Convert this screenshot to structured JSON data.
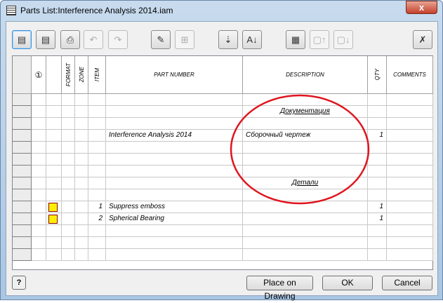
{
  "window": {
    "title": "Parts List:Interference Analysis 2014.iam",
    "close": "x"
  },
  "toolbar": [
    {
      "name": "save-bom-button",
      "glyph": "▤",
      "disabled": false,
      "selected": true
    },
    {
      "name": "column-chooser-button",
      "glyph": "▤",
      "disabled": false
    },
    {
      "name": "print-button",
      "glyph": "⎙",
      "disabled": false
    },
    {
      "name": "undo-button",
      "glyph": "↶",
      "disabled": true
    },
    {
      "name": "redo-button",
      "glyph": "↷",
      "disabled": true
    },
    {
      "name": "edit-button",
      "glyph": "✎",
      "disabled": false
    },
    {
      "name": "group-button",
      "glyph": "⊞",
      "disabled": true
    },
    {
      "name": "renumber-button",
      "glyph": "⇣",
      "disabled": false
    },
    {
      "name": "sort-button",
      "glyph": "A↓",
      "disabled": false
    },
    {
      "name": "add-row-button",
      "glyph": "▦",
      "disabled": false
    },
    {
      "name": "move-up-button",
      "glyph": "▢↑",
      "disabled": true
    },
    {
      "name": "move-down-button",
      "glyph": "▢↓",
      "disabled": true
    },
    {
      "name": "delete-button",
      "glyph": "✗",
      "disabled": false
    }
  ],
  "columns": {
    "balloon": "①",
    "format": "FORMAT",
    "zone": "ZONE",
    "item": "ITEM",
    "part_number": "PART NUMBER",
    "description": "DESCRIPTION",
    "qty": "QTY",
    "comments": "COMMENTS"
  },
  "rows": [
    {},
    {
      "description": "Документация",
      "section": true
    },
    {},
    {
      "part_number": "Interference Analysis 2014",
      "description": "Сборочный чертеж",
      "qty": "1"
    },
    {},
    {},
    {},
    {
      "description": "Детали",
      "section": true
    },
    {},
    {
      "icon": "part",
      "item": "1",
      "part_number": "Suppress emboss",
      "qty": "1"
    },
    {
      "icon": "part",
      "item": "2",
      "part_number": "Spherical Bearing",
      "qty": "1"
    },
    {},
    {},
    {}
  ],
  "buttons": {
    "help": "?",
    "place": "Place on Drawing",
    "ok": "OK",
    "cancel": "Cancel"
  },
  "colors": {
    "annotation": "#e0141e"
  }
}
